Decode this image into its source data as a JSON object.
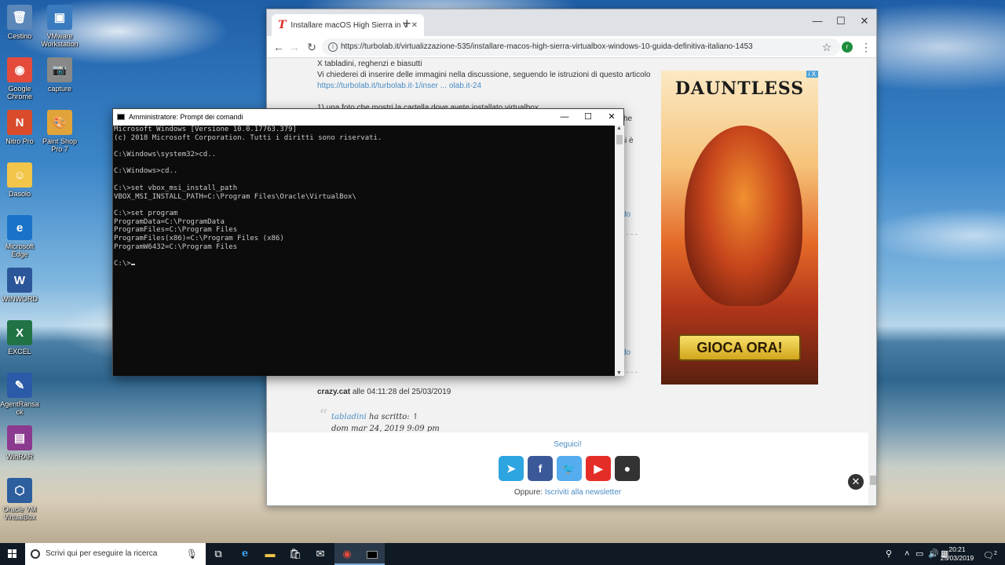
{
  "desktop_icons": [
    {
      "label": "Cestino",
      "glyph": "🗑",
      "color": "#5b87b9"
    },
    {
      "label": "VMware Workstation",
      "glyph": "▣",
      "color": "#3a7bbf"
    },
    {
      "label": "Google Chrome",
      "glyph": "◉",
      "color": "#e44b3b"
    },
    {
      "label": "capture",
      "glyph": "📷",
      "color": "#888888"
    },
    {
      "label": "Nitro Pro",
      "glyph": "N",
      "color": "#d94b2b"
    },
    {
      "label": "Paint Shop Pro 7",
      "glyph": "🎨",
      "color": "#e0a43a"
    },
    {
      "label": "Dasolo",
      "glyph": "☺",
      "color": "#f3c54a"
    },
    {
      "label": "Microsoft Edge",
      "glyph": "e",
      "color": "#1a73c8"
    },
    {
      "label": "WINWORD",
      "glyph": "W",
      "color": "#2b579a"
    },
    {
      "label": "EXCEL",
      "glyph": "X",
      "color": "#217346"
    },
    {
      "label": "AgentRansack",
      "glyph": "✎",
      "color": "#2a5aa8"
    },
    {
      "label": "WinRAR",
      "glyph": "▤",
      "color": "#8b3a8f"
    },
    {
      "label": "Oracle VM VirtualBox",
      "glyph": "⬡",
      "color": "#2d5e9e"
    }
  ],
  "chrome": {
    "tab_title": "Installare macOS High Sierra in V",
    "url": "https://turbolab.it/virtualizzazione-535/installare-macos-high-sierra-virtualbox-windows-10-guida-definitiva-italiano-1453",
    "profile_initial": "r"
  },
  "page": {
    "line1": "X tabladini, reghenzi e biasutti",
    "line2": "Vi chiederei di inserire delle immagini nella discussione, seguendo le istruzioni di questo articolo",
    "line3": "https://turbolab.it/turbolab.it-1/inser ... olab.it-24",
    "line4": "1) una foto che mostri la cartella dove avete installato virtualbox",
    "author": "crazy.cat",
    "author_meta": " alle 04:11:28 del 25/03/2019",
    "quote_user": "tabladini",
    "quote_said": " ha scritto: ↑",
    "quote_date": "dom mar 24, 2019 9:09 pm",
    "frag1": "he",
    "frag2": "si è",
    "frag3": "do",
    "frag4": "do",
    "ad_brand": "DAUNTLESS",
    "ad_cta": "GIOCA ORA!",
    "ad_badge": "i X",
    "follow_title": "Seguici!",
    "newsletter_prefix": "Oppure: ",
    "newsletter_link": "Iscriviti alla newsletter",
    "social": [
      {
        "name": "telegram",
        "glyph": "➤",
        "color": "#2ca5e0"
      },
      {
        "name": "facebook",
        "glyph": "f",
        "color": "#3b5998"
      },
      {
        "name": "twitter",
        "glyph": "🐦",
        "color": "#55acee"
      },
      {
        "name": "youtube",
        "glyph": "▶",
        "color": "#e52d27"
      },
      {
        "name": "github",
        "glyph": "●",
        "color": "#333333"
      }
    ]
  },
  "cmd": {
    "title": "Amministratore: Prompt dei comandi",
    "lines": [
      "Microsoft Windows [Versione 10.0.17763.379]",
      "(c) 2018 Microsoft Corporation. Tutti i diritti sono riservati.",
      "",
      "C:\\Windows\\system32>cd..",
      "",
      "C:\\Windows>cd..",
      "",
      "C:\\>set vbox_msi_install_path",
      "VBOX_MSI_INSTALL_PATH=C:\\Program Files\\Oracle\\VirtualBox\\",
      "",
      "C:\\>set program",
      "ProgramData=C:\\ProgramData",
      "ProgramFiles=C:\\Program Files",
      "ProgramFiles(x86)=C:\\Program Files (x86)",
      "ProgramW6432=C:\\Program Files",
      ""
    ],
    "prompt": "C:\\>"
  },
  "taskbar": {
    "search_placeholder": "Scrivi qui per eseguire la ricerca",
    "time": "20:21",
    "date": "25/03/2019",
    "notif_count": "2"
  }
}
